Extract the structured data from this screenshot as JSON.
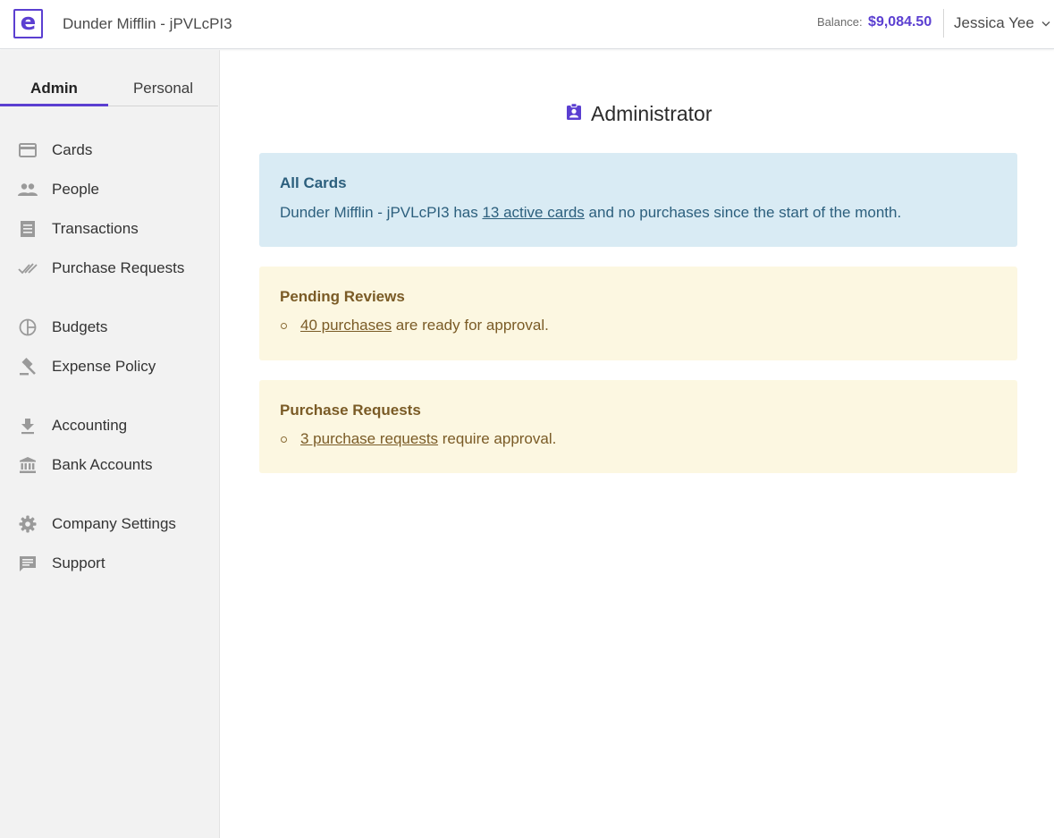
{
  "header": {
    "company_name": "Dunder Mifflin - jPVLcPI3",
    "balance_label": "Balance:",
    "balance_value": "$9,084.50",
    "user_name": "Jessica Yee"
  },
  "sidebar": {
    "tabs": [
      {
        "label": "Admin",
        "active": true
      },
      {
        "label": "Personal",
        "active": false
      }
    ],
    "items": [
      {
        "label": "Cards",
        "icon": "credit-card-icon"
      },
      {
        "label": "People",
        "icon": "people-icon"
      },
      {
        "label": "Transactions",
        "icon": "receipt-icon"
      },
      {
        "label": "Purchase Requests",
        "icon": "double-check-icon"
      },
      {
        "label": "Budgets",
        "icon": "pie-chart-icon"
      },
      {
        "label": "Expense Policy",
        "icon": "gavel-icon"
      },
      {
        "label": "Accounting",
        "icon": "download-icon"
      },
      {
        "label": "Bank Accounts",
        "icon": "bank-icon"
      },
      {
        "label": "Company Settings",
        "icon": "gear-icon"
      },
      {
        "label": "Support",
        "icon": "chat-icon"
      }
    ]
  },
  "main": {
    "title": "Administrator",
    "title_icon": "badge-icon",
    "all_cards": {
      "title": "All Cards",
      "text_prefix": "Dunder Mifflin - jPVLcPI3 has ",
      "link": "13 active cards",
      "text_suffix": " and no purchases since the start of the month."
    },
    "pending_reviews": {
      "title": "Pending Reviews",
      "link": "40 purchases",
      "text_suffix": " are ready for approval."
    },
    "purchase_requests": {
      "title": "Purchase Requests",
      "link": "3 purchase requests",
      "text_suffix": " require approval."
    }
  },
  "colors": {
    "accent": "#5b3fd1",
    "info_bg": "#d9ebf4",
    "info_text": "#2c5f7d",
    "warning_bg": "#fcf7e1",
    "warning_text": "#7a5b26"
  }
}
